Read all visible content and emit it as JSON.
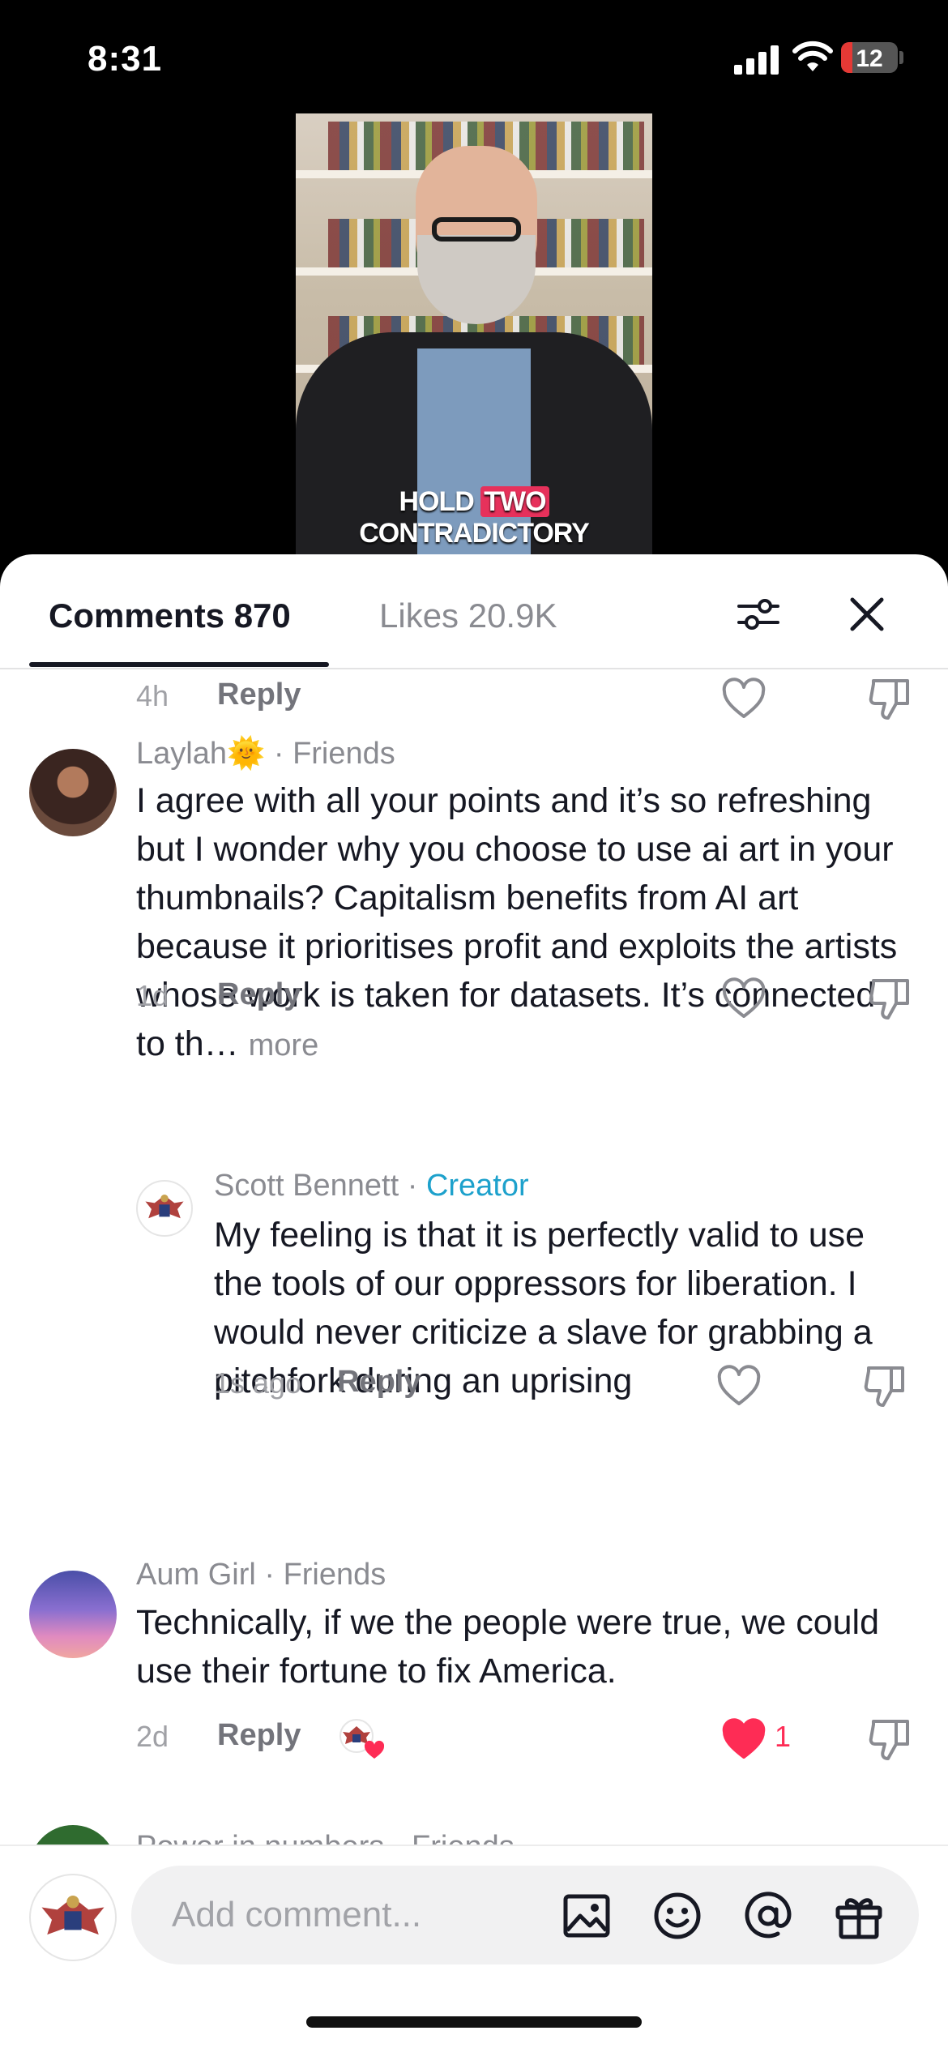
{
  "status_bar": {
    "time": "8:31",
    "battery": "12"
  },
  "video": {
    "caption_pre": "HOLD ",
    "caption_hl": "TWO",
    "caption_post": " CONTRADICTORY"
  },
  "tabs": {
    "comments": "Comments 870",
    "likes": "Likes 20.9K"
  },
  "comments": [
    {
      "time": "4h",
      "reply_label": "Reply"
    },
    {
      "author": "Laylah🌞",
      "relation": " · Friends",
      "text": "I agree with all your points and it’s so refreshing but I wonder why you choose to use ai art in your thumbnails? Capitalism benefits from AI art because it prioritises profit and exploits the artists whose work is taken for datasets. It’s connected to th…",
      "more": "more",
      "time": "1d",
      "reply_label": "Reply"
    },
    {
      "author": "Scott  Bennett",
      "relation": " · ",
      "badge": "Creator",
      "text": "My feeling is that it is perfectly valid to use the tools of our oppressors for liberation. I would never criticize a slave for grabbing a pitchfork during an uprising",
      "time": "1s ago",
      "reply_label": "Reply"
    },
    {
      "author": "Aum Girl",
      "relation": " · Friends",
      "text": "Technically, if we the people were true, we could use their fortune to fix America.",
      "time": "2d",
      "reply_label": "Reply",
      "like_count": "1",
      "liked": true,
      "liked_by_creator": true
    },
    {
      "author": "Power in numbers",
      "relation": " · Friends"
    }
  ],
  "composer": {
    "placeholder": "Add comment..."
  },
  "colors": {
    "like_red": "#fe2c55",
    "creator_blue": "#1da1cc"
  },
  "icons": [
    "filter-icon",
    "close-icon",
    "heart-icon",
    "dislike-icon",
    "image-icon",
    "emoji-icon",
    "mention-icon",
    "gift-icon"
  ]
}
